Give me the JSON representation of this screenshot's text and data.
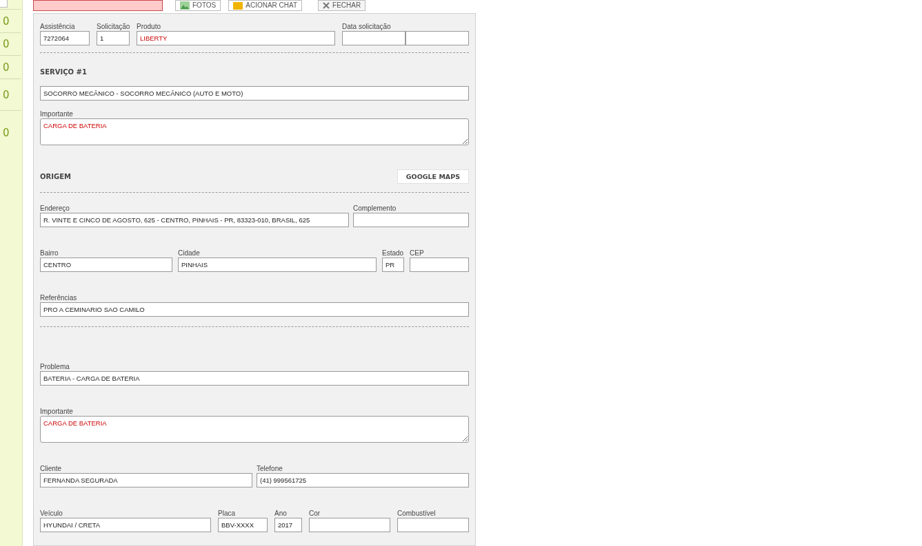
{
  "toolbar": {
    "buttons": [
      {
        "kind": "danger"
      },
      {
        "kind": "photos",
        "label": "FOTOS"
      },
      {
        "kind": "chat",
        "label": "ACIONAR CHAT"
      },
      {
        "kind": "close",
        "label": "FECHAR"
      }
    ]
  },
  "sidebar": {
    "items": [
      {
        "count": "0"
      },
      {
        "count": "0"
      },
      {
        "count": "0"
      },
      {
        "count": "0"
      },
      {
        "count": "0"
      }
    ]
  },
  "blocks": [
    {
      "kind": "row",
      "rule_after": true,
      "fields": [
        {
          "kind": "text",
          "label": "Assistência",
          "value": "7272064",
          "alert": false
        },
        {
          "kind": "text",
          "label": "Solicitação",
          "value": "1",
          "alert": false
        },
        {
          "kind": "text",
          "label": "Produto",
          "value": "LIBERTY",
          "alert": true
        },
        {
          "kind": "split",
          "label": "Data solicitação"
        }
      ]
    },
    {
      "kind": "heading",
      "title": "SERVIÇO #1"
    },
    {
      "kind": "row",
      "fields": [
        {
          "kind": "text",
          "value": "SOCORRO MECÂNICO - SOCORRO MECÂNICO (AUTO E MOTO)",
          "alert": false
        }
      ]
    },
    {
      "kind": "note",
      "label": "Importante",
      "value": "CARGA DE BATERIA",
      "alert": true
    },
    {
      "kind": "heading",
      "title": "ORIGEM",
      "button": "GOOGLE MAPS",
      "rule_after": true
    },
    {
      "kind": "row",
      "fields": [
        {
          "kind": "text",
          "label": "Endereço",
          "value": "R. VINTE E CINCO DE AGOSTO, 625 - CENTRO, PINHAIS - PR, 83323-010, BRASIL, 625",
          "alert": false
        },
        {
          "kind": "text",
          "label": "Complemento"
        }
      ]
    },
    {
      "kind": "row",
      "fields": [
        {
          "kind": "text",
          "label": "Bairro",
          "value": "CENTRO",
          "alert": false
        },
        {
          "kind": "text",
          "label": "Cidade",
          "value": "PINHAIS",
          "alert": false
        },
        {
          "kind": "text",
          "label": "Estado",
          "value": "PR",
          "alert": false
        },
        {
          "kind": "text",
          "label": "CEP"
        }
      ]
    },
    {
      "kind": "row",
      "rule_after": true,
      "fields": [
        {
          "kind": "text",
          "label": "Referências",
          "value": "PRO A CEMINARIO SAO CAMILO",
          "alert": false
        }
      ]
    },
    {
      "kind": "row",
      "fields": [
        {
          "kind": "text",
          "label": "Problema",
          "value": "BATERIA - CARGA DE BATERIA",
          "alert": false
        }
      ]
    },
    {
      "kind": "note",
      "label": "Importante",
      "value": "CARGA DE BATERIA",
      "alert": true
    },
    {
      "kind": "row",
      "fields": [
        {
          "kind": "text",
          "label": "Cliente",
          "value": "FERNANDA SEGURADA",
          "alert": false
        },
        {
          "kind": "text",
          "label": "Telefone",
          "value": "(41) 999561725",
          "alert": false
        }
      ]
    },
    {
      "kind": "row",
      "fields": [
        {
          "kind": "text",
          "label": "Veículo",
          "value": "HYUNDAI / CRETA",
          "alert": false
        },
        {
          "kind": "text",
          "label": "Placa",
          "value": "BBV-XXXX",
          "alert": false
        },
        {
          "kind": "text",
          "label": "Ano",
          "value": "2017",
          "alert": false
        },
        {
          "kind": "text",
          "label": "Cor"
        },
        {
          "kind": "text",
          "label": "Combustível"
        }
      ]
    }
  ]
}
